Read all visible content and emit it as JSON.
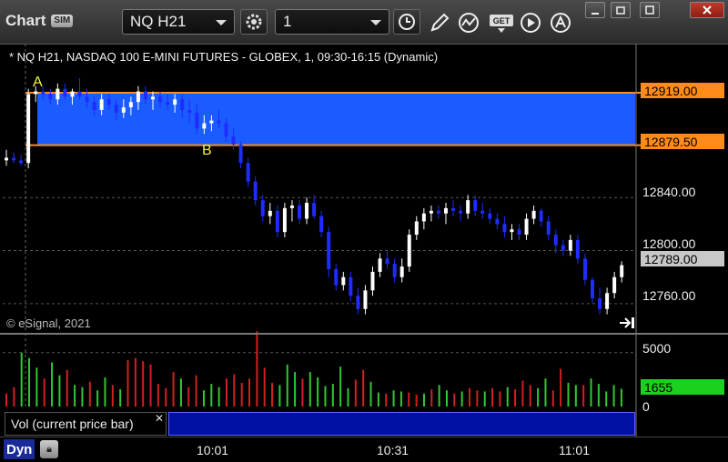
{
  "window": {
    "title": "Chart",
    "mode_badge": "SIM",
    "symbol": "NQ H21",
    "interval": "1"
  },
  "toolbar": {
    "icons": [
      "gear-icon",
      "clock-icon",
      "pencil-icon",
      "study-icon",
      "get-icon",
      "play-icon",
      "alert-icon"
    ]
  },
  "chart": {
    "title": "* NQ H21, NASDAQ 100 E-MINI FUTURES - GLOBEX, 1, 09:30-16:15 (Dynamic)",
    "copyright": "© eSignal, 2021",
    "zone_labels": {
      "a": "A",
      "b": "B"
    },
    "price_axis": [
      "12840.00",
      "12800.00",
      "12760.00"
    ],
    "price_tags": {
      "upper": "12919.00",
      "lower": "12879.50",
      "last": "12789.00"
    },
    "volume_axis": {
      "top": "5000",
      "bottom": "0"
    },
    "volume_tag": "1655",
    "volume_label": "Vol (current price bar)",
    "time_axis": [
      "10:01",
      "10:31",
      "11:01"
    ],
    "footer_mode": "Dyn"
  },
  "colors": {
    "zone_fill": "#1a5cff",
    "zone_line": "#ff8c1a",
    "up_candle": "#ffffff",
    "down_candle": "#1f2bff",
    "vol_up": "#32c832",
    "vol_down": "#d22020",
    "vol_tag": "#1ed01e"
  },
  "chart_data": {
    "type": "candlestick",
    "candles": [
      [
        12868,
        12876,
        12864,
        12870
      ],
      [
        12870,
        12874,
        12866,
        12868
      ],
      [
        12868,
        12872,
        12864,
        12866
      ],
      [
        12866,
        12922,
        12862,
        12918
      ],
      [
        12918,
        12924,
        12912,
        12920
      ],
      [
        12920,
        12924,
        12914,
        12918
      ],
      [
        12918,
        12922,
        12910,
        12914
      ],
      [
        12914,
        12926,
        12910,
        12922
      ],
      [
        12922,
        12926,
        12914,
        12916
      ],
      [
        12916,
        12922,
        12910,
        12920
      ],
      [
        12920,
        12930,
        12914,
        12916
      ],
      [
        12916,
        12922,
        12908,
        12912
      ],
      [
        12912,
        12916,
        12902,
        12906
      ],
      [
        12906,
        12918,
        12902,
        12914
      ],
      [
        12914,
        12918,
        12906,
        12910
      ],
      [
        12910,
        12914,
        12898,
        12904
      ],
      [
        12904,
        12914,
        12900,
        12908
      ],
      [
        12908,
        12916,
        12902,
        12912
      ],
      [
        12912,
        12924,
        12906,
        12920
      ],
      [
        12920,
        12924,
        12910,
        12914
      ],
      [
        12914,
        12920,
        12906,
        12916
      ],
      [
        12916,
        12920,
        12908,
        12912
      ],
      [
        12912,
        12918,
        12906,
        12910
      ],
      [
        12910,
        12918,
        12904,
        12914
      ],
      [
        12914,
        12918,
        12900,
        12906
      ],
      [
        12906,
        12914,
        12896,
        12904
      ],
      [
        12904,
        12910,
        12888,
        12892
      ],
      [
        12892,
        12902,
        12888,
        12896
      ],
      [
        12896,
        12902,
        12890,
        12898
      ],
      [
        12898,
        12906,
        12892,
        12896
      ],
      [
        12896,
        12900,
        12882,
        12886
      ],
      [
        12886,
        12892,
        12876,
        12880
      ],
      [
        12880,
        12882,
        12862,
        12866
      ],
      [
        12866,
        12870,
        12848,
        12852
      ],
      [
        12852,
        12856,
        12834,
        12838
      ],
      [
        12838,
        12842,
        12822,
        12826
      ],
      [
        12826,
        12836,
        12820,
        12830
      ],
      [
        12830,
        12834,
        12810,
        12814
      ],
      [
        12814,
        12836,
        12810,
        12832
      ],
      [
        12832,
        12838,
        12822,
        12834
      ],
      [
        12834,
        12838,
        12820,
        12824
      ],
      [
        12824,
        12840,
        12820,
        12836
      ],
      [
        12836,
        12842,
        12824,
        12826
      ],
      [
        12826,
        12830,
        12810,
        12814
      ],
      [
        12814,
        12818,
        12780,
        12786
      ],
      [
        12786,
        12790,
        12770,
        12774
      ],
      [
        12774,
        12784,
        12770,
        12780
      ],
      [
        12780,
        12784,
        12762,
        12766
      ],
      [
        12766,
        12772,
        12752,
        12756
      ],
      [
        12756,
        12774,
        12752,
        12770
      ],
      [
        12770,
        12788,
        12766,
        12784
      ],
      [
        12784,
        12798,
        12780,
        12794
      ],
      [
        12794,
        12800,
        12786,
        12790
      ],
      [
        12790,
        12794,
        12776,
        12780
      ],
      [
        12780,
        12794,
        12776,
        12788
      ],
      [
        12788,
        12816,
        12784,
        12812
      ],
      [
        12812,
        12826,
        12808,
        12822
      ],
      [
        12822,
        12832,
        12816,
        12828
      ],
      [
        12828,
        12834,
        12822,
        12830
      ],
      [
        12830,
        12834,
        12824,
        12828
      ],
      [
        12828,
        12836,
        12820,
        12832
      ],
      [
        12832,
        12838,
        12826,
        12830
      ],
      [
        12830,
        12834,
        12822,
        12828
      ],
      [
        12828,
        12842,
        12824,
        12838
      ],
      [
        12838,
        12842,
        12826,
        12830
      ],
      [
        12830,
        12836,
        12824,
        12828
      ],
      [
        12828,
        12832,
        12820,
        12824
      ],
      [
        12824,
        12828,
        12816,
        12820
      ],
      [
        12820,
        12826,
        12810,
        12814
      ],
      [
        12814,
        12820,
        12808,
        12816
      ],
      [
        12816,
        12820,
        12808,
        12812
      ],
      [
        12812,
        12828,
        12808,
        12824
      ],
      [
        12824,
        12834,
        12820,
        12830
      ],
      [
        12830,
        12832,
        12818,
        12822
      ],
      [
        12822,
        12826,
        12808,
        12812
      ],
      [
        12812,
        12816,
        12798,
        12804
      ],
      [
        12804,
        12808,
        12796,
        12800
      ],
      [
        12800,
        12812,
        12796,
        12808
      ],
      [
        12808,
        12812,
        12790,
        12794
      ],
      [
        12794,
        12798,
        12774,
        12778
      ],
      [
        12778,
        12780,
        12760,
        12764
      ],
      [
        12764,
        12772,
        12752,
        12756
      ],
      [
        12756,
        12772,
        12752,
        12768
      ],
      [
        12768,
        12784,
        12764,
        12780
      ],
      [
        12780,
        12792,
        12776,
        12789
      ]
    ],
    "price_range": [
      12738,
      12956
    ],
    "upper_level": 12919.0,
    "lower_level": 12879.5,
    "volume": [
      [
        1200,
        0
      ],
      [
        1800,
        0
      ],
      [
        5000,
        1
      ],
      [
        4500,
        1
      ],
      [
        3600,
        1
      ],
      [
        2600,
        0
      ],
      [
        4100,
        1
      ],
      [
        2900,
        1
      ],
      [
        3400,
        0
      ],
      [
        2000,
        1
      ],
      [
        1800,
        1
      ],
      [
        2300,
        0
      ],
      [
        1500,
        1
      ],
      [
        2700,
        1
      ],
      [
        2000,
        0
      ],
      [
        1600,
        1
      ],
      [
        4300,
        0
      ],
      [
        4500,
        0
      ],
      [
        4200,
        0
      ],
      [
        3900,
        0
      ],
      [
        2100,
        0
      ],
      [
        1700,
        0
      ],
      [
        3200,
        0
      ],
      [
        2600,
        1
      ],
      [
        1800,
        0
      ],
      [
        2900,
        0
      ],
      [
        1500,
        1
      ],
      [
        2100,
        1
      ],
      [
        1800,
        1
      ],
      [
        2600,
        0
      ],
      [
        3000,
        0
      ],
      [
        2200,
        0
      ],
      [
        2600,
        0
      ],
      [
        7000,
        0
      ],
      [
        3600,
        0
      ],
      [
        2200,
        0
      ],
      [
        2000,
        1
      ],
      [
        3900,
        1
      ],
      [
        3200,
        1
      ],
      [
        2600,
        0
      ],
      [
        3200,
        1
      ],
      [
        2700,
        1
      ],
      [
        1900,
        1
      ],
      [
        2100,
        1
      ],
      [
        3700,
        1
      ],
      [
        1700,
        1
      ],
      [
        2500,
        0
      ],
      [
        3400,
        0
      ],
      [
        2300,
        1
      ],
      [
        1300,
        1
      ],
      [
        1200,
        0
      ],
      [
        1500,
        1
      ],
      [
        1400,
        1
      ],
      [
        1300,
        0
      ],
      [
        1100,
        0
      ],
      [
        1200,
        1
      ],
      [
        1600,
        0
      ],
      [
        2000,
        1
      ],
      [
        1500,
        1
      ],
      [
        1200,
        0
      ],
      [
        1400,
        1
      ],
      [
        1700,
        0
      ],
      [
        1500,
        0
      ],
      [
        1400,
        1
      ],
      [
        1700,
        0
      ],
      [
        1400,
        0
      ],
      [
        1800,
        1
      ],
      [
        1600,
        0
      ],
      [
        2400,
        0
      ],
      [
        2000,
        0
      ],
      [
        1700,
        1
      ],
      [
        2600,
        1
      ],
      [
        1500,
        0
      ],
      [
        3500,
        0
      ],
      [
        2200,
        1
      ],
      [
        2000,
        1
      ],
      [
        2000,
        0
      ],
      [
        2600,
        1
      ],
      [
        2100,
        1
      ],
      [
        1400,
        1
      ],
      [
        2000,
        1
      ],
      [
        1655,
        1
      ]
    ],
    "volume_range": [
      0,
      6500
    ]
  }
}
